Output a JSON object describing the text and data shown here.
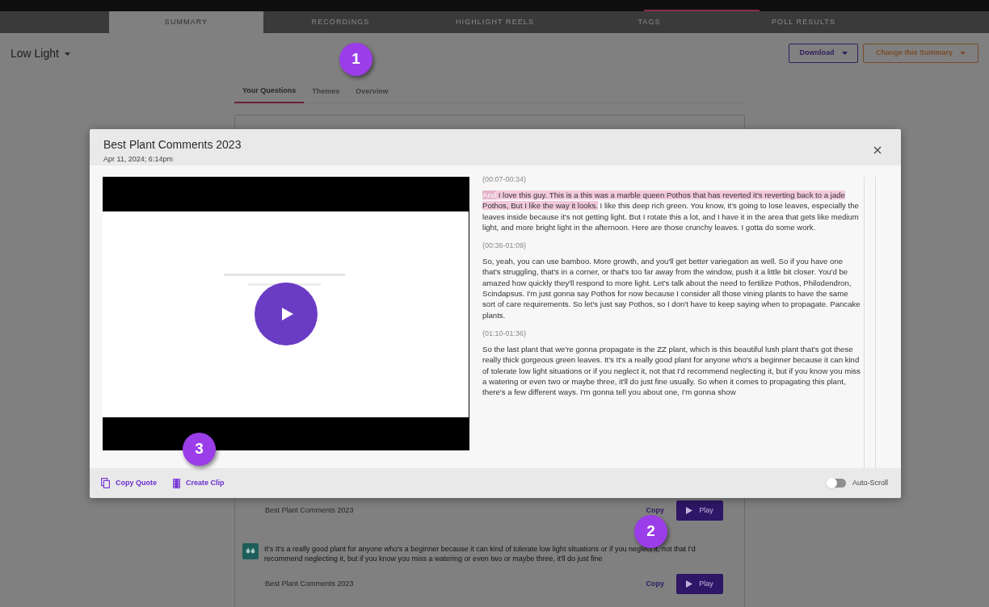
{
  "sub_tabs": [
    {
      "label": "SUMMARY",
      "selected": true
    },
    {
      "label": "RECORDINGS",
      "selected": false
    },
    {
      "label": "HIGHLIGHT REELS",
      "selected": false
    },
    {
      "label": "TAGS",
      "selected": false
    },
    {
      "label": "POLL RESULTS",
      "selected": false
    }
  ],
  "summary_select": "Low Light",
  "buttons": [
    {
      "label": "Download",
      "kind": "primary"
    },
    {
      "label": "Change this Summary",
      "kind": "secondary"
    }
  ],
  "question_tabs": [
    {
      "label": "Your Questions",
      "selected": true
    },
    {
      "label": "Themes",
      "selected": false
    },
    {
      "label": "Overview",
      "selected": false
    }
  ],
  "results": [
    {
      "kind": "source",
      "source": "Best Plant Comments 2023",
      "copy": "Copy",
      "play": "Play"
    },
    {
      "kind": "quote",
      "quote": "It's It's a really good plant for anyone who's a beginner because it can kind of tolerate low light situations or if you neglect it, not that I'd recommend neglecting it, but if you know you miss a watering or even two or maybe three, it'll do just fine",
      "source": "Best Plant Comments 2023",
      "copy": "Copy",
      "play": "Play"
    }
  ],
  "modal": {
    "title": "Best Plant Comments 2023",
    "date": "Apr 11, 2024; 6:14pm",
    "transcript": [
      {
        "time": "(00:07-00:34)",
        "parts": [
          {
            "kind": "selected",
            "text": "And"
          },
          {
            "kind": "highlight",
            "text": " I love this guy. This is a this was a marble queen Pothos that has reverted it's reverting back to a jade Pothos, But I like the way it looks."
          },
          {
            "kind": "plain",
            "text": " I like this deep rich green. You know, it's going to lose leaves, especially the leaves inside because it's not getting light. But I rotate this a lot, and I have it in the area that gets like medium light, and more bright light in the afternoon. Here are those crunchy leaves. I gotta do some work."
          }
        ]
      },
      {
        "time": "(00:36-01:09)",
        "parts": [
          {
            "kind": "plain",
            "text": "So, yeah, you can use bamboo. More growth, and you'll get better variegation as well. So if you have one that's struggling, that's in a corner, or that's too far away from the window, push it a little bit closer. You'd be amazed how quickly they'll respond to more light. Let's talk about the need to fertilize Pothos, Philodendron, Scindapsus. I'm just gonna say Pothos for now because I consider all those vining plants to have the same sort of care requirements. So let's just say Pothos, so I don't have to keep saying when to propagate. Pancake plants."
          }
        ]
      },
      {
        "time": "(01:10-01:36)",
        "parts": [
          {
            "kind": "plain",
            "text": "So the last plant that we're gonna propagate is the ZZ plant, which is this beautiful lush plant that's got these really thick gorgeous green leaves. It's It's a really good plant for anyone who's a beginner because it can kind of tolerate low light situations or if you neglect it, not that I'd recommend neglecting it, but if you know you miss a watering or even two or maybe three, it'll do just fine usually. So when it comes to propagating this plant, there's a few different ways. I'm gonna tell you about one, I'm gonna show"
          }
        ]
      }
    ],
    "actions": [
      {
        "kind": "copy",
        "label": "Copy Quote"
      },
      {
        "kind": "clip",
        "label": "Create Clip"
      }
    ],
    "auto_scroll": {
      "label": "Auto-Scroll",
      "on": false
    }
  },
  "callouts": [
    "1",
    "2",
    "3"
  ]
}
